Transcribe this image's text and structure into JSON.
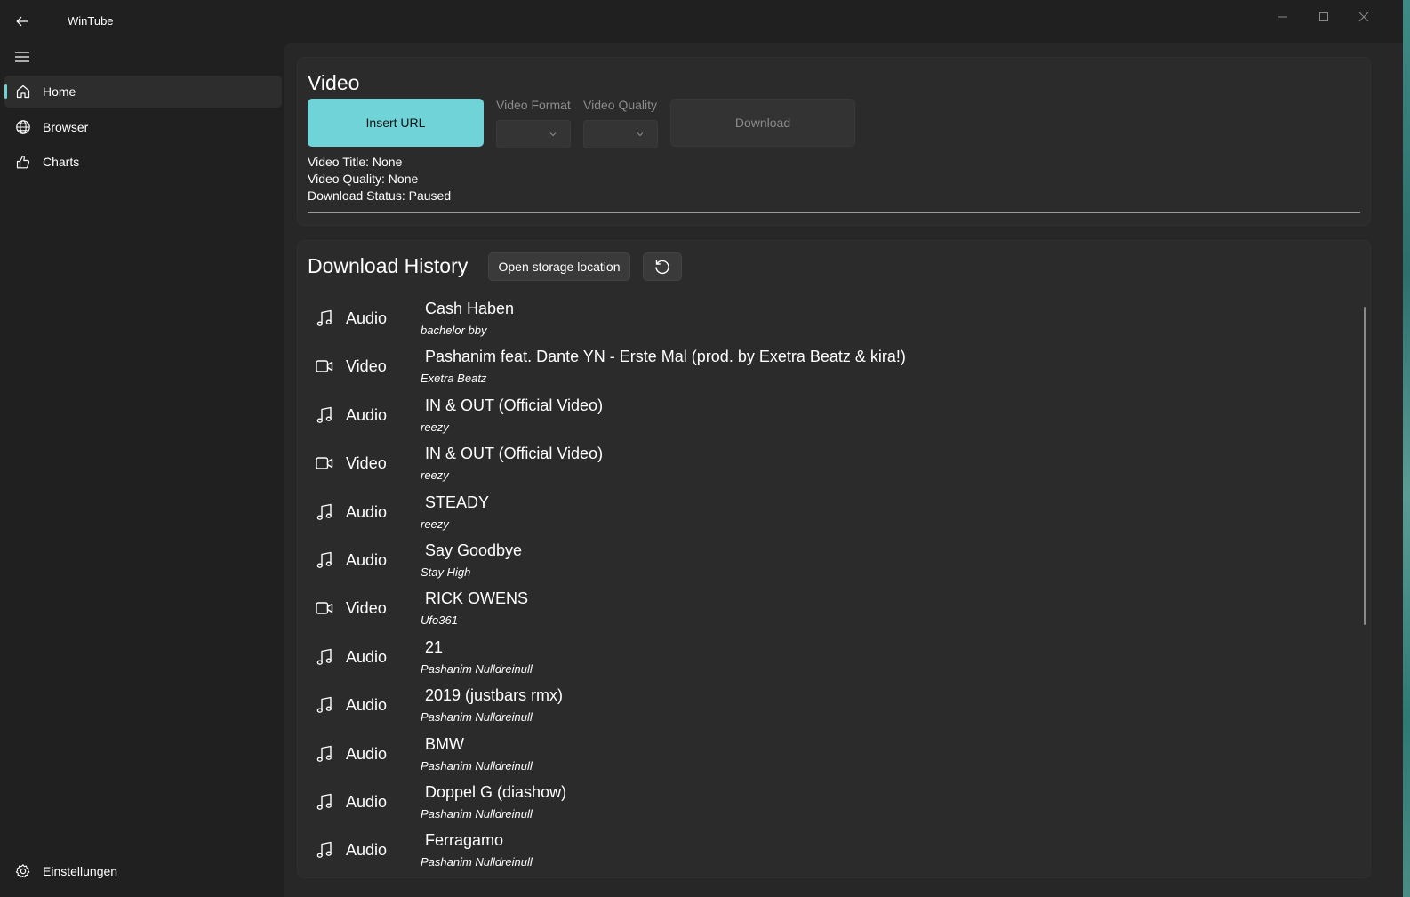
{
  "app": {
    "title": "WinTube"
  },
  "sidebar": {
    "items": [
      {
        "label": "Home",
        "icon": "home-icon",
        "selected": true
      },
      {
        "label": "Browser",
        "icon": "globe-icon",
        "selected": false
      },
      {
        "label": "Charts",
        "icon": "thumbs-up-icon",
        "selected": false
      }
    ],
    "settings_label": "Einstellungen"
  },
  "video": {
    "heading": "Video",
    "insert_url_label": "Insert URL",
    "format_label": "Video Format",
    "quality_label": "Video Quality",
    "download_label": "Download",
    "info_title": "Video Title: None",
    "info_quality": "Video Quality: None",
    "info_status": "Download Status: Paused"
  },
  "history": {
    "heading": "Download History",
    "open_storage_label": "Open storage location",
    "items": [
      {
        "type": "Audio",
        "icon": "music-note-icon",
        "title": "Cash Haben",
        "artist": "bachelor bby"
      },
      {
        "type": "Video",
        "icon": "video-camera-icon",
        "title": "Pashanim feat. Dante YN - Erste Mal (prod. by Exetra Beatz & kira!)",
        "artist": "Exetra Beatz"
      },
      {
        "type": "Audio",
        "icon": "music-note-icon",
        "title": "IN & OUT (Official Video)",
        "artist": "reezy"
      },
      {
        "type": "Video",
        "icon": "video-camera-icon",
        "title": "IN & OUT (Official Video)",
        "artist": "reezy"
      },
      {
        "type": "Audio",
        "icon": "music-note-icon",
        "title": "STEADY",
        "artist": "reezy"
      },
      {
        "type": "Audio",
        "icon": "music-note-icon",
        "title": "Say Goodbye",
        "artist": "Stay High"
      },
      {
        "type": "Video",
        "icon": "video-camera-icon",
        "title": "RICK OWENS",
        "artist": "Ufo361"
      },
      {
        "type": "Audio",
        "icon": "music-note-icon",
        "title": "21",
        "artist": "Pashanim Nulldreinull"
      },
      {
        "type": "Audio",
        "icon": "music-note-icon",
        "title": "2019 (justbars rmx)",
        "artist": "Pashanim Nulldreinull"
      },
      {
        "type": "Audio",
        "icon": "music-note-icon",
        "title": "BMW",
        "artist": "Pashanim Nulldreinull"
      },
      {
        "type": "Audio",
        "icon": "music-note-icon",
        "title": "Doppel G (diashow)",
        "artist": "Pashanim Nulldreinull"
      },
      {
        "type": "Audio",
        "icon": "music-note-icon",
        "title": "Ferragamo",
        "artist": "Pashanim Nulldreinull"
      }
    ]
  },
  "colors": {
    "accent": "#6fd3d8",
    "background": "#202020",
    "card": "#2b2b2b"
  }
}
